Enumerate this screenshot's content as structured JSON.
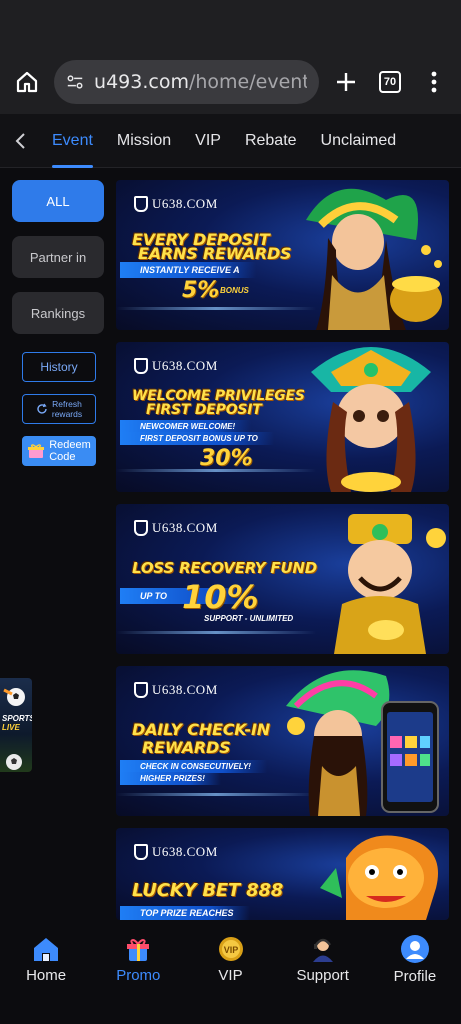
{
  "browser": {
    "url_main": "u493.com",
    "url_rest": "/home/event?c",
    "tab_count": "70"
  },
  "tabs": [
    {
      "label": "Event",
      "active": true
    },
    {
      "label": "Mission"
    },
    {
      "label": "VIP"
    },
    {
      "label": "Rebate"
    },
    {
      "label": "Unclaimed"
    }
  ],
  "sidebar": {
    "all": "ALL",
    "partner": "Partner in",
    "rankings": "Rankings",
    "history": "History",
    "refresh_line1": "Refresh",
    "refresh_line2": "rewards",
    "redeem_line1": "Redeem",
    "redeem_line2": "Code"
  },
  "sports": {
    "line1": "SPORTS",
    "line2": "LIVE"
  },
  "banners": [
    {
      "logo": "U638.COM",
      "headline1": "EVERY DEPOSIT",
      "headline2": "EARNS REWARDS",
      "pill": "INSTANTLY RECEIVE A",
      "big": "5%",
      "small": "BONUS"
    },
    {
      "logo": "U638.COM",
      "headline1": "WELCOME PRIVILEGES",
      "headline2": "FIRST DEPOSIT",
      "pill1": "NEWCOMER WELCOME!",
      "pill2": "FIRST DEPOSIT BONUS UP TO",
      "big": "30%"
    },
    {
      "logo": "U638.COM",
      "headline1": "LOSS RECOVERY FUND",
      "pill": "UP TO",
      "big": "10%",
      "small": "SUPPORT - UNLIMITED"
    },
    {
      "logo": "U638.COM",
      "headline1": "DAILY CHECK-IN",
      "headline2": "REWARDS",
      "pill1": "CHECK IN CONSECUTIVELY!",
      "pill2": "HIGHER PRIZES!"
    },
    {
      "logo": "U638.COM",
      "headline1": "LUCKY BET 888",
      "pill": "TOP PRIZE REACHES"
    }
  ],
  "bottom_nav": [
    {
      "label": "Home",
      "icon": "home-icon"
    },
    {
      "label": "Promo",
      "icon": "promo-icon",
      "active": true
    },
    {
      "label": "VIP",
      "icon": "vip-icon"
    },
    {
      "label": "Support",
      "icon": "support-icon"
    },
    {
      "label": "Profile",
      "icon": "profile-icon"
    }
  ],
  "colors": {
    "accent": "#3d8bfd",
    "gold": "#ffd33b",
    "banner_bg": "#0b1a55"
  }
}
